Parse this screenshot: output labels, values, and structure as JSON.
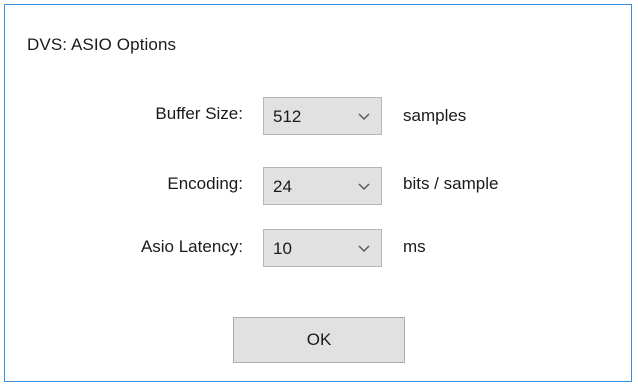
{
  "dialog": {
    "title": "DVS: ASIO Options"
  },
  "rows": [
    {
      "label": "Buffer Size:",
      "value": "512",
      "unit": "samples"
    },
    {
      "label": "Encoding:",
      "value": "24",
      "unit": "bits / sample"
    },
    {
      "label": "Asio Latency:",
      "value": "10",
      "unit": "ms"
    }
  ],
  "buttons": {
    "ok_label": "OK"
  },
  "icons": {
    "dropdown": "chevron-down-icon"
  },
  "colors": {
    "window_border": "#3c8ee0",
    "control_background": "#e1e1e1"
  }
}
